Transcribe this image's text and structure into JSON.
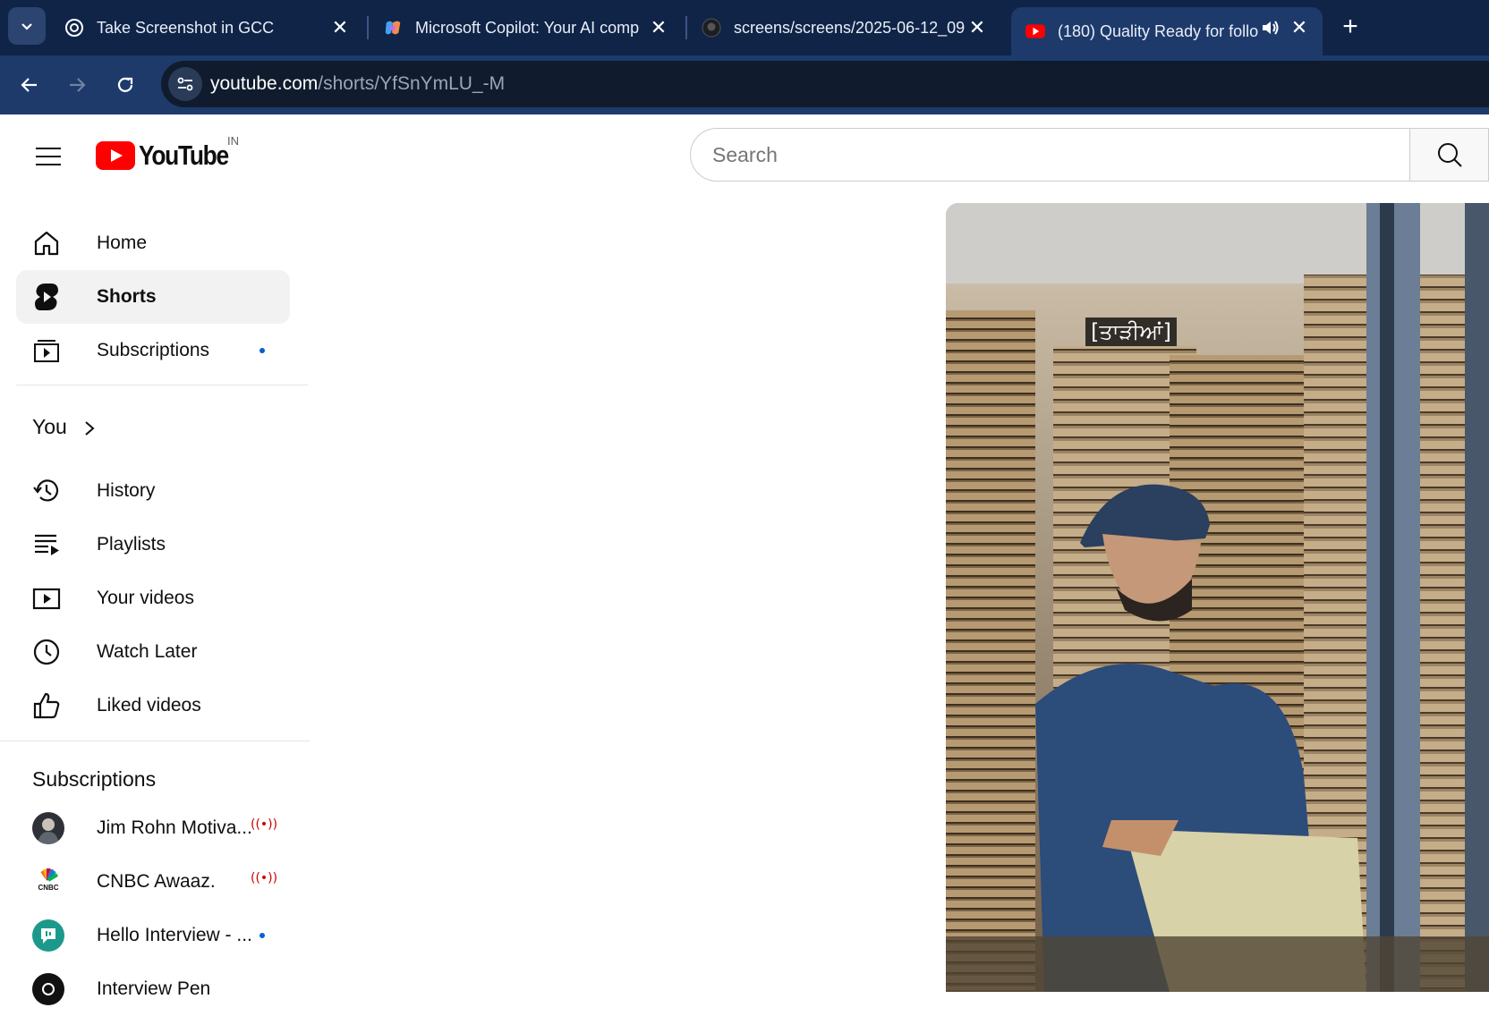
{
  "browser": {
    "tabs": [
      {
        "title": "Take Screenshot in GCC",
        "icon": "openai-icon",
        "active": false
      },
      {
        "title": "Microsoft Copilot: Your AI comp",
        "icon": "copilot-icon",
        "active": false
      },
      {
        "title": "screens/screens/2025-06-12_09",
        "icon": "github-icon",
        "active": false
      },
      {
        "title": "(180) Quality Ready for follo",
        "icon": "youtube-icon",
        "active": true,
        "audio": true
      }
    ],
    "url_host": "youtube.com",
    "url_path": "/shorts/YfSnYmLU_-M"
  },
  "youtube": {
    "logo_text": "YouTube",
    "region": "IN",
    "search_placeholder": "Search",
    "nav": {
      "home": "Home",
      "shorts": "Shorts",
      "subscriptions": "Subscriptions"
    },
    "you": {
      "title": "You",
      "items": {
        "history": "History",
        "playlists": "Playlists",
        "your_videos": "Your videos",
        "watch_later": "Watch Later",
        "liked_videos": "Liked videos"
      }
    },
    "subscriptions": {
      "title": "Subscriptions",
      "channels": [
        {
          "name": "Jim Rohn Motiva...",
          "status": "live"
        },
        {
          "name": "CNBC Awaaz.",
          "status": "live",
          "avatar_text": "CNBC"
        },
        {
          "name": "Hello Interview - ...",
          "status": "new"
        },
        {
          "name": "Interview Pen",
          "status": ""
        }
      ]
    },
    "video": {
      "caption": "[ਤਾੜੀਆਂ]"
    }
  },
  "colors": {
    "tabbar": "#0f2447",
    "toolbar": "#1d3a6b",
    "youtube_red": "#ff0000",
    "live_red": "#cc0000",
    "new_dot": "#065fd4"
  }
}
